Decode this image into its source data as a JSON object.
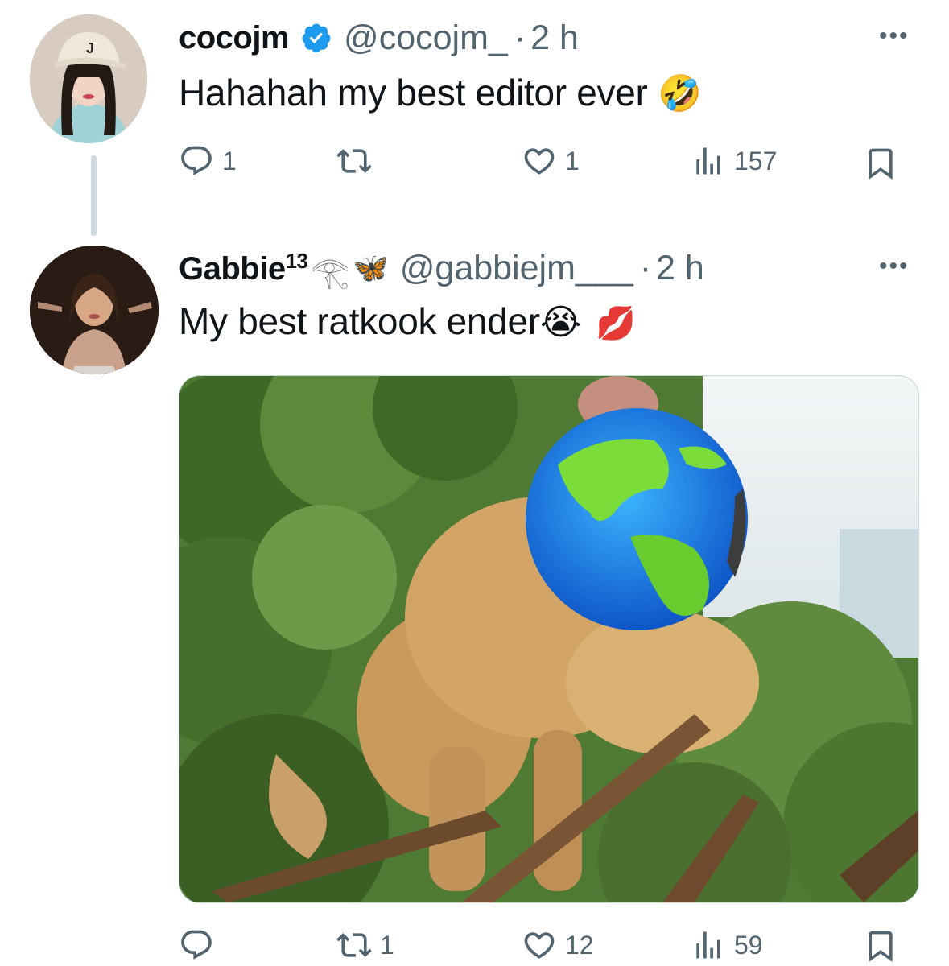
{
  "tweet1": {
    "display_name": "cocojm",
    "handle": "@cocojm_",
    "separator": "·",
    "time": "2 h",
    "text": "Hahahah my best editor ever",
    "emoji": "🤣",
    "more_label": "•••",
    "actions": {
      "replies": "1",
      "reposts": "",
      "likes": "1",
      "views": "157"
    }
  },
  "tweet2": {
    "display_name": "Gabbie",
    "name_suffix": "13",
    "name_emoji_1": "𓂀",
    "name_emoji_2": "🦋",
    "handle": "@gabbiejm___",
    "separator": "·",
    "time": "2 h",
    "text": "My best ratkook ender",
    "emoji_1": "😭",
    "emoji_2": "💋",
    "more_label": "•••",
    "actions": {
      "replies": "",
      "reposts": "1",
      "likes": "12",
      "views": "59"
    }
  },
  "colors": {
    "text": "#0f1419",
    "secondary": "#536471",
    "verified": "#1d9bf0",
    "border": "#cfd9de"
  }
}
